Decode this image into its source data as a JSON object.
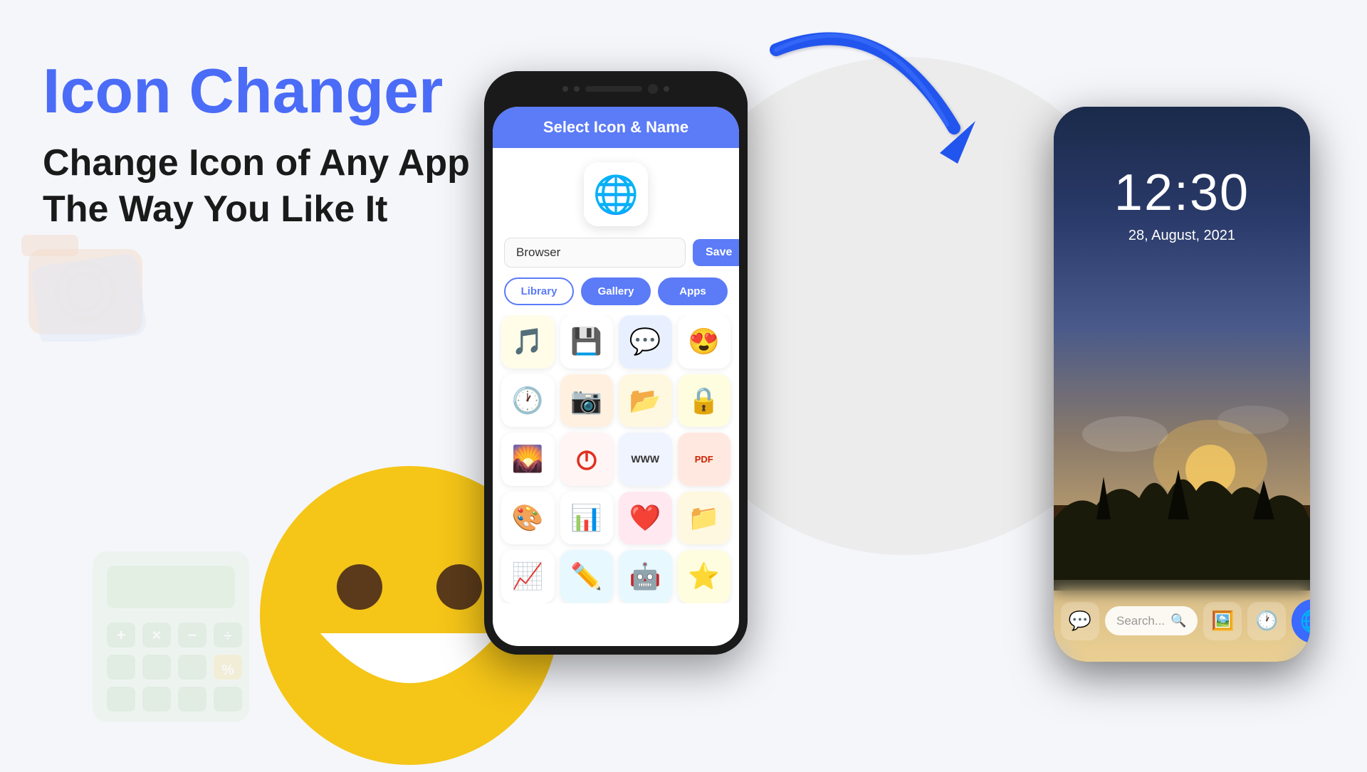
{
  "page": {
    "background_color": "#f5f6fa"
  },
  "left_section": {
    "title": "Icon Changer",
    "subtitle_line1": "Change Icon of Any App",
    "subtitle_line2": "The Way You Like It",
    "title_color": "#4b6cf7"
  },
  "phone_left": {
    "header_title": "Select Icon & Name",
    "app_name_value": "Browser",
    "save_button_label": "Save",
    "tabs": [
      {
        "label": "Library",
        "active": true
      },
      {
        "label": "Gallery",
        "active": false
      },
      {
        "label": "Apps",
        "active": false
      }
    ],
    "icons": [
      {
        "emoji": "🎵",
        "name": "music"
      },
      {
        "emoji": "💾",
        "name": "save"
      },
      {
        "emoji": "💬",
        "name": "chat"
      },
      {
        "emoji": "😍",
        "name": "love-face"
      },
      {
        "emoji": "🕐",
        "name": "clock"
      },
      {
        "emoji": "📷",
        "name": "camera"
      },
      {
        "emoji": "📂",
        "name": "folder-open"
      },
      {
        "emoji": "🔒",
        "name": "lock"
      },
      {
        "emoji": "🌄",
        "name": "landscape"
      },
      {
        "emoji": "⏻",
        "name": "power"
      },
      {
        "emoji": "🌐",
        "name": "www"
      },
      {
        "emoji": "📄",
        "name": "pdf"
      },
      {
        "emoji": "🎨",
        "name": "color-wheel"
      },
      {
        "emoji": "📊",
        "name": "spreadsheet"
      },
      {
        "emoji": "❤️",
        "name": "heart"
      },
      {
        "emoji": "📁",
        "name": "folder-gold"
      },
      {
        "emoji": "📈",
        "name": "chart"
      },
      {
        "emoji": "✏️",
        "name": "edit"
      },
      {
        "emoji": "🤖",
        "name": "robot"
      },
      {
        "emoji": "⭐",
        "name": "star"
      }
    ]
  },
  "phone_right": {
    "time": "12:30",
    "date": "28, August, 2021",
    "search_placeholder": "Search...",
    "dock_icons": [
      {
        "emoji": "💬",
        "name": "chat-dock"
      },
      {
        "emoji": "🖼️",
        "name": "gallery-dock"
      },
      {
        "emoji": "🕐",
        "name": "clock-dock"
      }
    ],
    "browser_icon": "🌐"
  },
  "arrow": {
    "color": "#3366ff",
    "description": "curved-arrow-pointing-down"
  }
}
